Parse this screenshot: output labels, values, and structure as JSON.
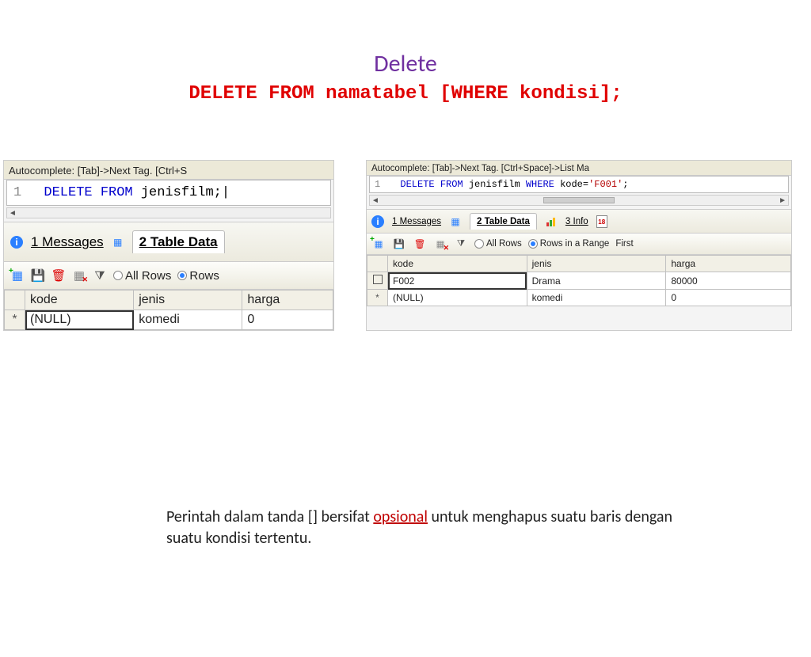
{
  "title": "Delete",
  "syntax": "DELETE FROM namatabel [WHERE kondisi];",
  "left": {
    "autocomplete": "Autocomplete: [Tab]->Next Tag. [Ctrl+S",
    "line_no": "1",
    "sql_kw1": "DELETE FROM",
    "sql_tbl": "jenisfilm;",
    "tabs": {
      "messages": "1 Messages",
      "tabledata": "2 Table Data"
    },
    "radios": {
      "all": "All Rows",
      "range": "Rows"
    },
    "table": {
      "headers": [
        "kode",
        "jenis",
        "harga"
      ],
      "rows": [
        {
          "marker": "*",
          "kode": "(NULL)",
          "jenis": "komedi",
          "harga": "0",
          "kode_selected": true
        }
      ]
    }
  },
  "right": {
    "autocomplete": "Autocomplete: [Tab]->Next Tag. [Ctrl+Space]->List Ma",
    "line_no": "1",
    "sql_kw1": "DELETE FROM",
    "sql_tbl": "jenisfilm",
    "sql_kw2": "WHERE",
    "sql_rest_plain": "kode=",
    "sql_rest_str": "'F001'",
    "sql_rest_end": ";",
    "tabs": {
      "messages": "1 Messages",
      "tabledata": "2 Table Data",
      "info": "3 Info"
    },
    "radios": {
      "all": "All Rows",
      "range": "Rows in a Range",
      "first": "First"
    },
    "table": {
      "headers": [
        "kode",
        "jenis",
        "harga"
      ],
      "rows": [
        {
          "marker_checkbox": true,
          "kode": "F002",
          "jenis": "Drama",
          "harga": "80000",
          "kode_selected": true
        },
        {
          "marker": "*",
          "kode": "(NULL)",
          "jenis": "komedi",
          "harga": "0"
        }
      ]
    }
  },
  "caption_pre": "Perintah dalam tanda [] bersifat ",
  "caption_op": "opsional",
  "caption_post": " untuk menghapus suatu baris dengan suatu kondisi tertentu."
}
